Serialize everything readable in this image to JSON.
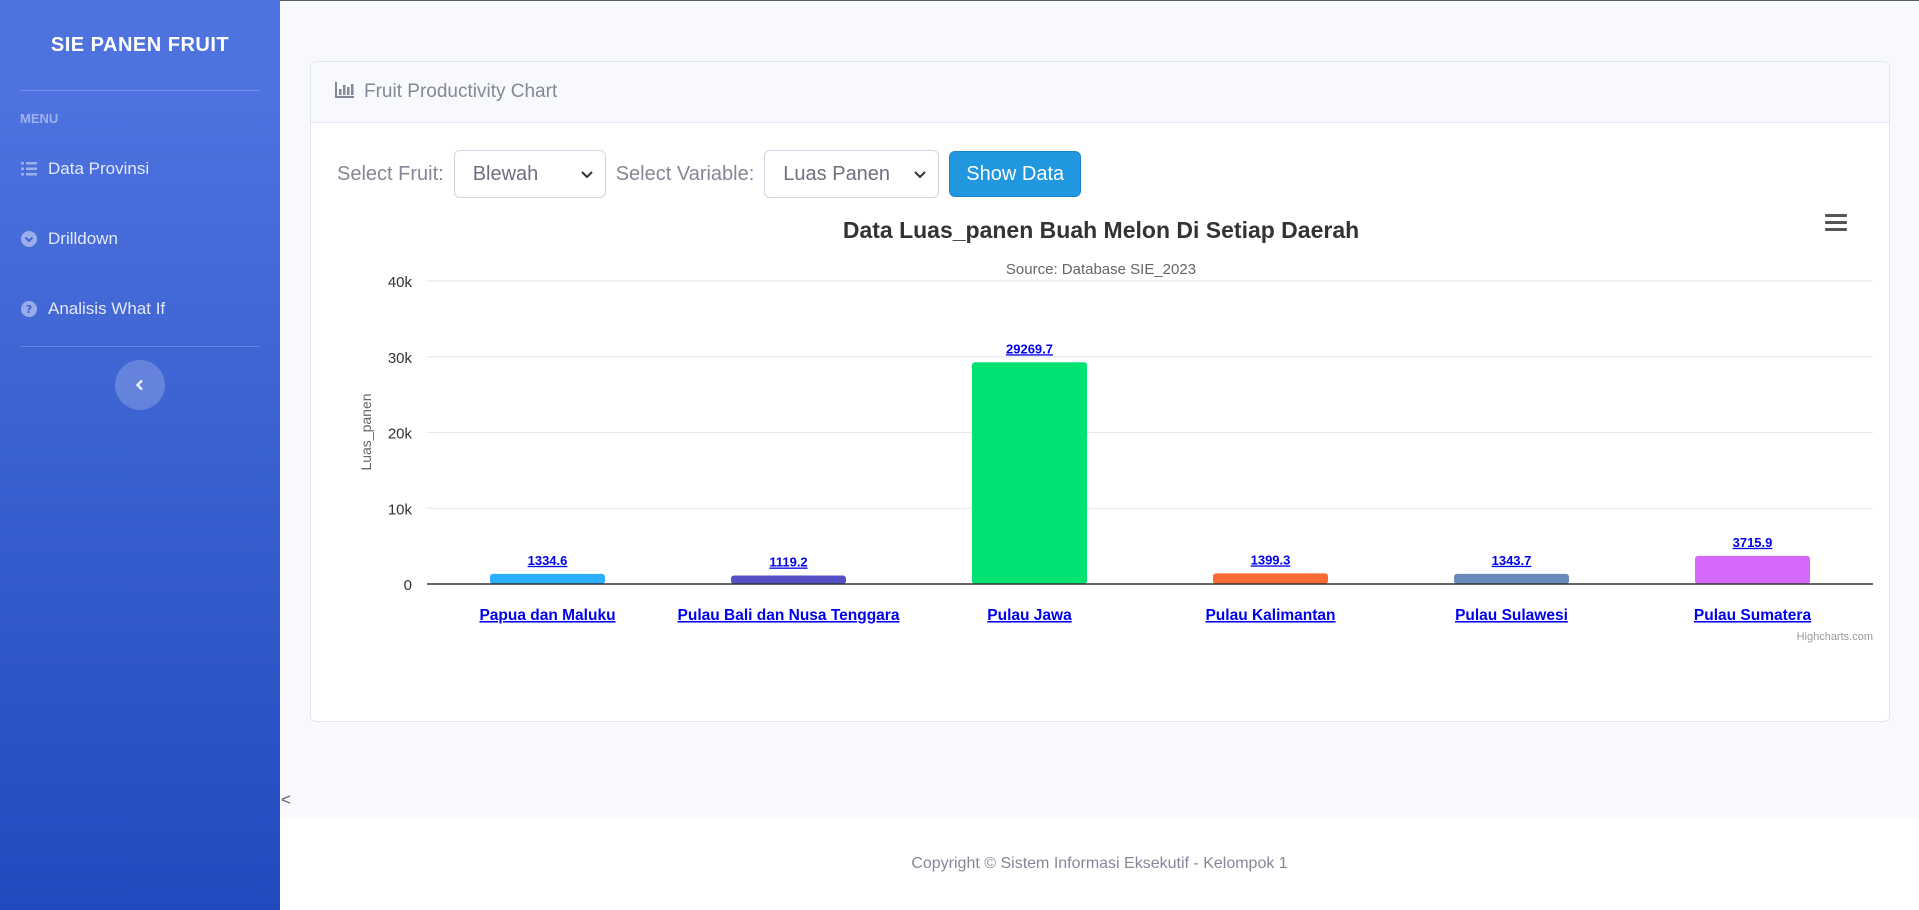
{
  "sidebar": {
    "brand": "SIE PANEN FRUIT",
    "menu_heading": "MENU",
    "items": [
      {
        "label": "Data Provinsi",
        "icon": "list-icon"
      },
      {
        "label": "Drilldown",
        "icon": "chevron-circle-down-icon"
      },
      {
        "label": "Analisis What If",
        "icon": "question-circle-icon"
      }
    ],
    "toggle_glyph": "<"
  },
  "back_arrow": "<",
  "card": {
    "title": "Fruit Productivity Chart",
    "icon": "bar-chart-icon"
  },
  "controls": {
    "fruit_label": "Select Fruit:",
    "fruit_value": "Blewah",
    "variable_label": "Select Variable:",
    "variable_value": "Luas Panen",
    "show_button": "Show Data"
  },
  "chart_data": {
    "type": "bar",
    "title": "Data Luas_panen Buah Melon Di Setiap Daerah",
    "subtitle": "Source: Database SIE_2023",
    "ylabel": "Luas_panen",
    "xlabel": "",
    "ylim": [
      0,
      40000
    ],
    "yticks": [
      "0",
      "10k",
      "20k",
      "30k",
      "40k"
    ],
    "grid": true,
    "categories": [
      "Papua dan Maluku",
      "Pulau Bali dan Nusa Tenggara",
      "Pulau Jawa",
      "Pulau Kalimantan",
      "Pulau Sulawesi",
      "Pulau Sumatera"
    ],
    "values": [
      1334.6,
      1119.2,
      29269.7,
      1399.3,
      1343.7,
      3715.9
    ],
    "data_labels": [
      "1334.6",
      "1119.2",
      "29269.7",
      "1399.3",
      "1343.7",
      "3715.9"
    ],
    "colors": [
      "#2caffe",
      "#544fc5",
      "#00e272",
      "#fe6a35",
      "#6b8abc",
      "#d568fb"
    ],
    "credits": "Highcharts.com"
  },
  "footer": {
    "text": "Copyright © Sistem Informasi Eksekutif - Kelompok 1"
  }
}
